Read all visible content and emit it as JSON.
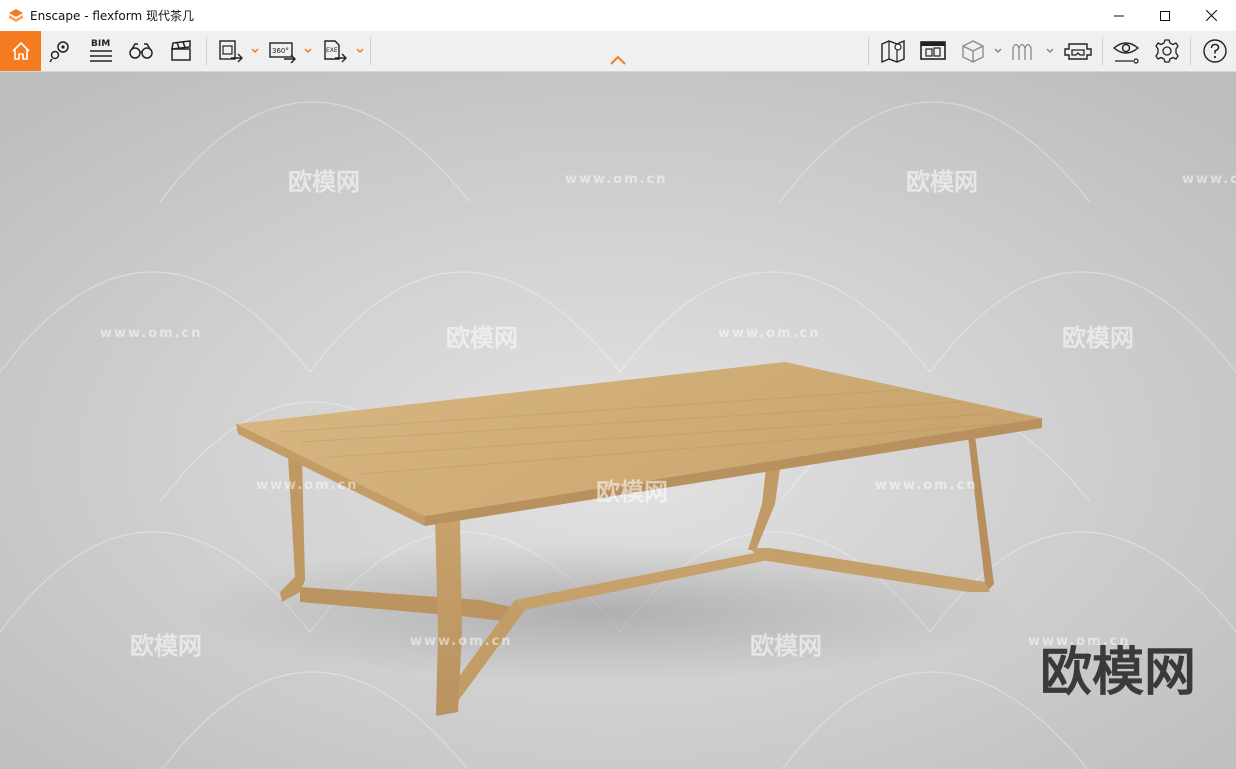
{
  "window": {
    "title": "Enscape - flexform 现代茶几",
    "minimize_glyph": "—",
    "maximize_glyph": "☐",
    "close_glyph": "✕"
  },
  "toolbar": {
    "bim_label": "BIM",
    "icon_texts": {
      "pano": "360°",
      "exe": "EXE"
    },
    "accent_color": "#f47b20",
    "left_icons": [
      "home-icon",
      "map-pin-icon",
      "bim-icon",
      "binoculars-icon",
      "clapperboard-icon",
      "screenshot-export-icon",
      "panorama-export-icon",
      "exe-export-icon"
    ],
    "right_icons": [
      "map-icon",
      "render-window-icon",
      "cube-icon",
      "arches-icon",
      "vr-headset-icon",
      "eye-path-icon",
      "gear-icon",
      "help-icon"
    ]
  },
  "viewport": {
    "watermark_url": "www.om.cn",
    "watermark_brand": "欧模网",
    "corner_mark": "欧模网"
  }
}
